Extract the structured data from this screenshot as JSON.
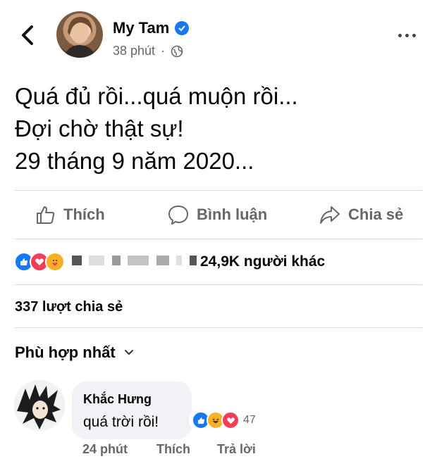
{
  "post": {
    "author": "My Tam",
    "time": "38 phút",
    "lines": [
      "Quá đủ rồi...quá muộn rồi...",
      "Đợi chờ thật sự!",
      "29 tháng 9 năm 2020..."
    ]
  },
  "actions": {
    "like": "Thích",
    "comment": "Bình luận",
    "share": "Chia sẻ"
  },
  "reactions_summary": "24,9K người khác",
  "shares": "337 lượt chia sẻ",
  "sort_label": "Phù hợp nhất",
  "comment": {
    "author": "Khắc Hưng",
    "text": "quá trời rồi!",
    "reaction_count": "47",
    "time": "24 phút",
    "like": "Thích",
    "reply": "Trả lời"
  }
}
